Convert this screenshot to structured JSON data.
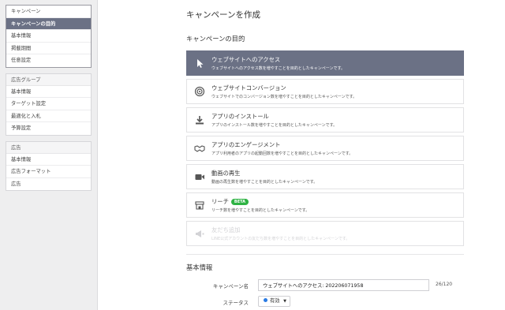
{
  "sidebar": {
    "campaign_group": {
      "items": [
        {
          "label": "キャンペーン"
        },
        {
          "label": "キャンペーンの目的"
        },
        {
          "label": "基本情報"
        },
        {
          "label": "掲載期間"
        },
        {
          "label": "任意設定"
        }
      ]
    },
    "adgroup_group": {
      "header": "広告グループ",
      "items": [
        {
          "label": "基本情報"
        },
        {
          "label": "ターゲット設定"
        },
        {
          "label": "最適化と入札"
        },
        {
          "label": "予算設定"
        }
      ]
    },
    "ad_group": {
      "header": "広告",
      "items": [
        {
          "label": "基本情報"
        },
        {
          "label": "広告フォーマット"
        },
        {
          "label": "広告"
        }
      ]
    }
  },
  "main": {
    "page_title": "キャンペーンを作成",
    "objective_section_title": "キャンペーンの目的",
    "objectives": [
      {
        "title": "ウェブサイトへのアクセス",
        "desc": "ウェブサイトへのアクセス数を増やすことを目的としたキャンペーンです。",
        "icon": "cursor-icon",
        "state": "selected"
      },
      {
        "title": "ウェブサイトコンバージョン",
        "desc": "ウェブサイトでのコンバージョン数を増やすことを目的としたキャンペーンです。",
        "icon": "target-icon",
        "state": "normal"
      },
      {
        "title": "アプリのインストール",
        "desc": "アプリのインストール数を増やすことを目的としたキャンペーンです。",
        "icon": "download-icon",
        "state": "normal"
      },
      {
        "title": "アプリのエンゲージメント",
        "desc": "アプリ利用者のアプリの起動回数を増やすことを目的としたキャンペーンです。",
        "icon": "handshake-icon",
        "state": "normal"
      },
      {
        "title": "動画の再生",
        "desc": "動画の再生数を増やすことを目的としたキャンペーンです。",
        "icon": "video-camera-icon",
        "state": "normal"
      },
      {
        "title": "リーチ",
        "desc": "リーチ数を増やすことを目的としたキャンペーンです。",
        "icon": "storefront-icon",
        "state": "normal",
        "badge": "BETA"
      },
      {
        "title": "友だち追加",
        "desc": "LINE公式アカウントの友だち数を増やすことを目的としたキャンペーンです。",
        "icon": "megaphone-icon",
        "state": "disabled"
      }
    ],
    "basic_section_title": "基本情報",
    "campaign_name_label": "キャンペーン名",
    "campaign_name_value": "ウェブサイトへのアクセス: 202206071958",
    "char_count": "26",
    "char_max": "/120",
    "status_label": "ステータス",
    "status_value": "有効",
    "status_color": "#2a7be4",
    "accent_color": "#6b7185"
  }
}
